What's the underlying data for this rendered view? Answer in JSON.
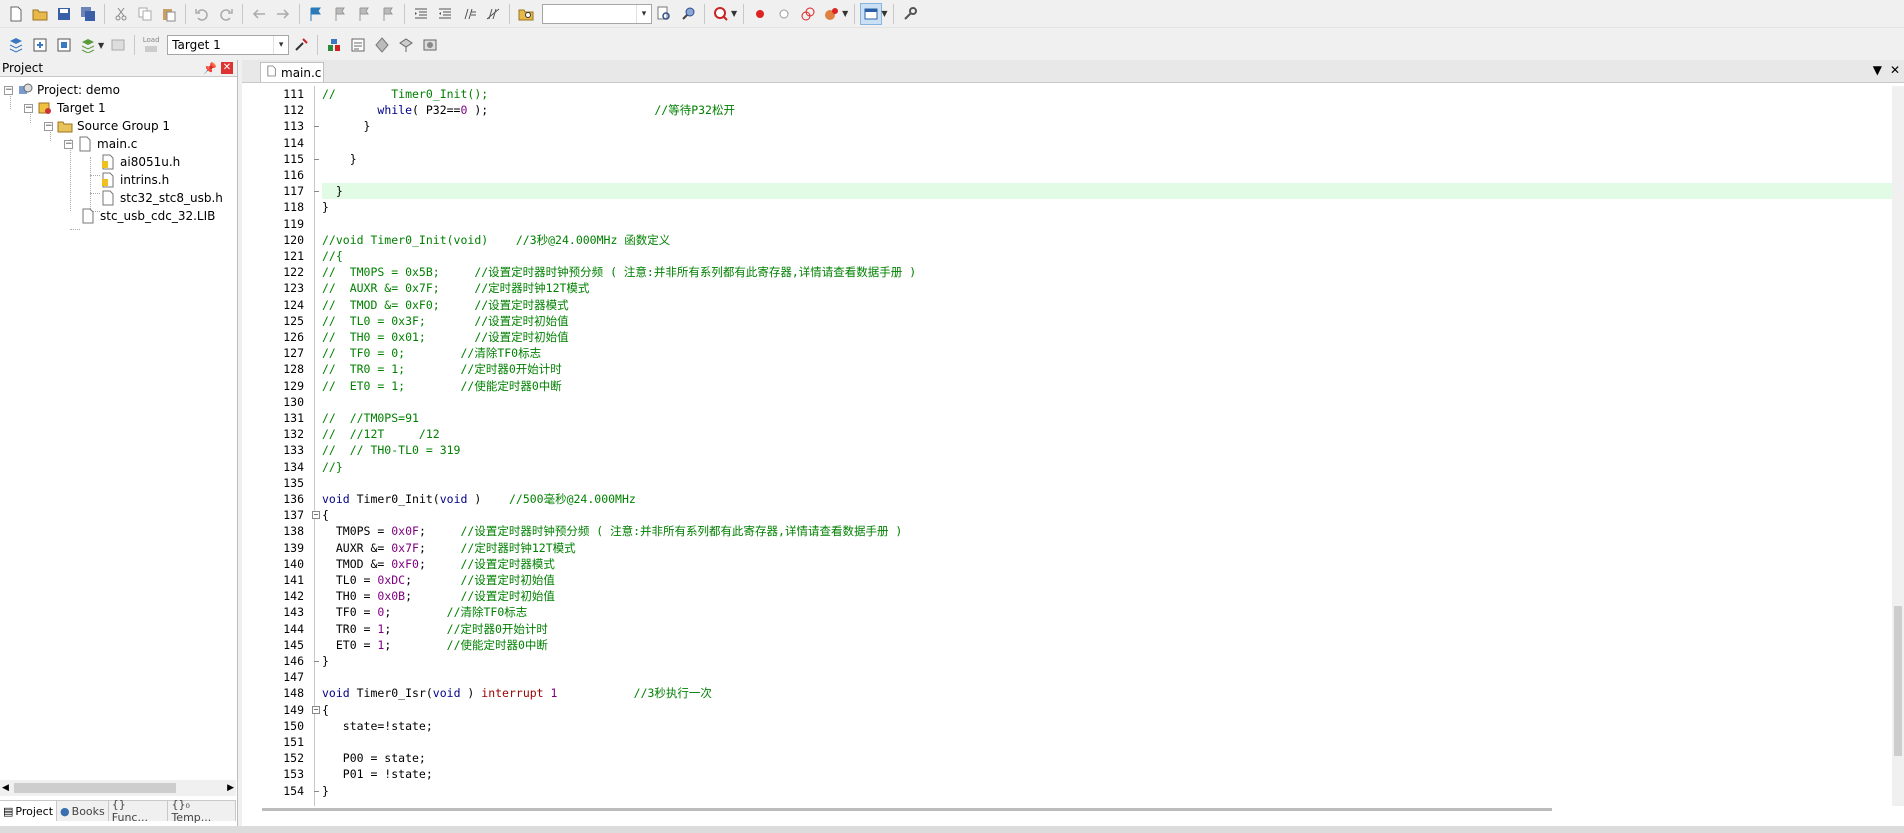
{
  "toolbar1": {
    "icons": [
      "new-file-icon",
      "open-folder-icon",
      "save-icon",
      "save-all-icon",
      "cut-icon",
      "copy-icon",
      "paste-icon",
      "undo-icon",
      "redo-icon",
      "navigate-back-icon",
      "navigate-forward-icon",
      "bookmark-icon",
      "prev-bookmark-icon",
      "next-bookmark-icon",
      "clear-bookmarks-icon",
      "indent-icon",
      "unindent-icon",
      "comment-icon",
      "uncomment-icon",
      "find-in-files-icon",
      "find-combo",
      "find-icon",
      "incremental-find-icon",
      "debug-session-icon",
      "breakpoint-icon",
      "disable-breakpoint-icon",
      "kill-breakpoints-icon",
      "trace-icon",
      "window-layout-icon",
      "configure-icon"
    ]
  },
  "toolbar2": {
    "target_label": "Target 1",
    "load_label": "Load"
  },
  "project_panel": {
    "title": "Project",
    "tree": [
      {
        "label": "Project: demo",
        "level": 0,
        "icon": "project-icon"
      },
      {
        "label": "Target 1",
        "level": 1,
        "icon": "target-icon"
      },
      {
        "label": "Source Group 1",
        "level": 2,
        "icon": "folder-icon"
      },
      {
        "label": "main.c",
        "level": 3,
        "icon": "file-icon"
      },
      {
        "label": "ai8051u.h",
        "level": 4,
        "icon": "header-locked-icon"
      },
      {
        "label": "intrins.h",
        "level": 4,
        "icon": "header-locked-icon"
      },
      {
        "label": "stc32_stc8_usb.h",
        "level": 4,
        "icon": "file-icon"
      },
      {
        "label": "stc_usb_cdc_32.LIB",
        "level": 3,
        "icon": "file-icon"
      }
    ],
    "tabs": [
      "Project",
      "Books",
      "{} Func...",
      "{}₀ Temp..."
    ]
  },
  "editor": {
    "tab_label": "main.c",
    "highlight_line": 117,
    "lines": [
      {
        "n": "111",
        "fold": "",
        "parts": [
          [
            "cmt",
            "//        Timer0_Init();"
          ]
        ]
      },
      {
        "n": "112",
        "fold": "",
        "parts": [
          [
            "",
            "        "
          ],
          [
            "kw",
            "while"
          ],
          [
            "",
            "( P32=="
          ],
          [
            "num",
            "0"
          ],
          [
            "",
            " );                        "
          ],
          [
            "cmt",
            "//等待P32松开"
          ]
        ]
      },
      {
        "n": "113",
        "fold": "end",
        "parts": [
          [
            "",
            "      }"
          ]
        ]
      },
      {
        "n": "114",
        "fold": "",
        "parts": [
          [
            "",
            ""
          ]
        ]
      },
      {
        "n": "115",
        "fold": "end",
        "parts": [
          [
            "",
            "    }"
          ]
        ]
      },
      {
        "n": "116",
        "fold": "",
        "parts": [
          [
            "",
            ""
          ]
        ]
      },
      {
        "n": "117",
        "fold": "end",
        "parts": [
          [
            "",
            "  }"
          ]
        ]
      },
      {
        "n": "118",
        "fold": "",
        "parts": [
          [
            "",
            "}"
          ]
        ]
      },
      {
        "n": "119",
        "fold": "",
        "parts": [
          [
            "",
            ""
          ]
        ]
      },
      {
        "n": "120",
        "fold": "",
        "parts": [
          [
            "cmt",
            "//void Timer0_Init(void)    //3秒@24.000MHz 函数定义"
          ]
        ]
      },
      {
        "n": "121",
        "fold": "",
        "parts": [
          [
            "cmt",
            "//{"
          ]
        ]
      },
      {
        "n": "122",
        "fold": "",
        "parts": [
          [
            "cmt",
            "//  TM0PS = 0x5B;     //设置定时器时钟预分频 ( 注意:并非所有系列都有此寄存器,详情请查看数据手册 )"
          ]
        ]
      },
      {
        "n": "123",
        "fold": "",
        "parts": [
          [
            "cmt",
            "//  AUXR &= 0x7F;     //定时器时钟12T模式"
          ]
        ]
      },
      {
        "n": "124",
        "fold": "",
        "parts": [
          [
            "cmt",
            "//  TMOD &= 0xF0;     //设置定时器模式"
          ]
        ]
      },
      {
        "n": "125",
        "fold": "",
        "parts": [
          [
            "cmt",
            "//  TL0 = 0x3F;       //设置定时初始值"
          ]
        ]
      },
      {
        "n": "126",
        "fold": "",
        "parts": [
          [
            "cmt",
            "//  TH0 = 0x01;       //设置定时初始值"
          ]
        ]
      },
      {
        "n": "127",
        "fold": "",
        "parts": [
          [
            "cmt",
            "//  TF0 = 0;        //清除TF0标志"
          ]
        ]
      },
      {
        "n": "128",
        "fold": "",
        "parts": [
          [
            "cmt",
            "//  TR0 = 1;        //定时器0开始计时"
          ]
        ]
      },
      {
        "n": "129",
        "fold": "",
        "parts": [
          [
            "cmt",
            "//  ET0 = 1;        //使能定时器0中断"
          ]
        ]
      },
      {
        "n": "130",
        "fold": "",
        "parts": [
          [
            "",
            ""
          ]
        ]
      },
      {
        "n": "131",
        "fold": "",
        "parts": [
          [
            "cmt",
            "//  //TM0PS=91"
          ]
        ]
      },
      {
        "n": "132",
        "fold": "",
        "parts": [
          [
            "cmt",
            "//  //12T     /12"
          ]
        ]
      },
      {
        "n": "133",
        "fold": "",
        "parts": [
          [
            "cmt",
            "//  // TH0-TL0 = 319"
          ]
        ]
      },
      {
        "n": "134",
        "fold": "",
        "parts": [
          [
            "cmt",
            "//}"
          ]
        ]
      },
      {
        "n": "135",
        "fold": "",
        "parts": [
          [
            "",
            ""
          ]
        ]
      },
      {
        "n": "136",
        "fold": "",
        "parts": [
          [
            "kw",
            "void"
          ],
          [
            "",
            " Timer0_Init("
          ],
          [
            "kw",
            "void"
          ],
          [
            "",
            " )    "
          ],
          [
            "cmt",
            "//500毫秒@24.000MHz"
          ]
        ]
      },
      {
        "n": "137",
        "fold": "open",
        "parts": [
          [
            "",
            "{"
          ]
        ]
      },
      {
        "n": "138",
        "fold": "",
        "parts": [
          [
            "",
            "  TM0PS = "
          ],
          [
            "num",
            "0x0F"
          ],
          [
            "",
            ";     "
          ],
          [
            "cmt",
            "//设置定时器时钟预分频 ( 注意:并非所有系列都有此寄存器,详情请查看数据手册 )"
          ]
        ]
      },
      {
        "n": "139",
        "fold": "",
        "parts": [
          [
            "",
            "  AUXR &= "
          ],
          [
            "num",
            "0x7F"
          ],
          [
            "",
            ";     "
          ],
          [
            "cmt",
            "//定时器时钟12T模式"
          ]
        ]
      },
      {
        "n": "140",
        "fold": "",
        "parts": [
          [
            "",
            "  TMOD &= "
          ],
          [
            "num",
            "0xF0"
          ],
          [
            "",
            ";     "
          ],
          [
            "cmt",
            "//设置定时器模式"
          ]
        ]
      },
      {
        "n": "141",
        "fold": "",
        "parts": [
          [
            "",
            "  TL0 = "
          ],
          [
            "num",
            "0xDC"
          ],
          [
            "",
            ";       "
          ],
          [
            "cmt",
            "//设置定时初始值"
          ]
        ]
      },
      {
        "n": "142",
        "fold": "",
        "parts": [
          [
            "",
            "  TH0 = "
          ],
          [
            "num",
            "0x0B"
          ],
          [
            "",
            ";       "
          ],
          [
            "cmt",
            "//设置定时初始值"
          ]
        ]
      },
      {
        "n": "143",
        "fold": "",
        "parts": [
          [
            "",
            "  TF0 = "
          ],
          [
            "num",
            "0"
          ],
          [
            "",
            ";        "
          ],
          [
            "cmt",
            "//清除TF0标志"
          ]
        ]
      },
      {
        "n": "144",
        "fold": "",
        "parts": [
          [
            "",
            "  TR0 = "
          ],
          [
            "num",
            "1"
          ],
          [
            "",
            ";        "
          ],
          [
            "cmt",
            "//定时器0开始计时"
          ]
        ]
      },
      {
        "n": "145",
        "fold": "",
        "parts": [
          [
            "",
            "  ET0 = "
          ],
          [
            "num",
            "1"
          ],
          [
            "",
            ";        "
          ],
          [
            "cmt",
            "//使能定时器0中断"
          ]
        ]
      },
      {
        "n": "146",
        "fold": "end",
        "parts": [
          [
            "",
            "}"
          ]
        ]
      },
      {
        "n": "147",
        "fold": "",
        "parts": [
          [
            "",
            ""
          ]
        ]
      },
      {
        "n": "148",
        "fold": "",
        "parts": [
          [
            "kw",
            "void"
          ],
          [
            "",
            " Timer0_Isr("
          ],
          [
            "kw",
            "void"
          ],
          [
            "",
            " ) "
          ],
          [
            "kw2",
            "interrupt"
          ],
          [
            "",
            " "
          ],
          [
            "num",
            "1"
          ],
          [
            "",
            "           "
          ],
          [
            "cmt",
            "//3秒执行一次"
          ]
        ]
      },
      {
        "n": "149",
        "fold": "open",
        "parts": [
          [
            "",
            "{"
          ]
        ]
      },
      {
        "n": "150",
        "fold": "",
        "parts": [
          [
            "",
            "   state=!state;"
          ]
        ]
      },
      {
        "n": "151",
        "fold": "",
        "parts": [
          [
            "",
            ""
          ]
        ]
      },
      {
        "n": "152",
        "fold": "",
        "parts": [
          [
            "",
            "   P00 = state;"
          ]
        ]
      },
      {
        "n": "153",
        "fold": "",
        "parts": [
          [
            "",
            "   P01 = !state;"
          ]
        ]
      },
      {
        "n": "154",
        "fold": "end",
        "parts": [
          [
            "",
            "}"
          ]
        ]
      }
    ]
  }
}
